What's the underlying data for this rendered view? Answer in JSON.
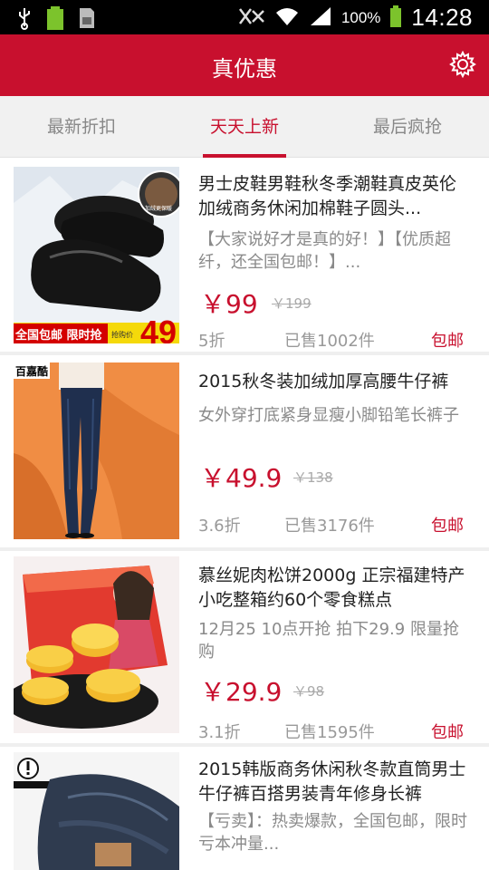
{
  "status_bar": {
    "battery_percent": "100%",
    "time": "14:28"
  },
  "app_bar": {
    "title": "真优惠"
  },
  "tabs": [
    {
      "label": "最新折扣",
      "active": false
    },
    {
      "label": "天天上新",
      "active": true
    },
    {
      "label": "最后疯抢",
      "active": false
    }
  ],
  "products": [
    {
      "title": "男士皮鞋男鞋秋冬季潮鞋真皮英伦加绒商务休闲加棉鞋子圆头...",
      "description": "【大家说好才是真的好！】【优质超纤，还全国包邮！】...",
      "price": "￥99",
      "original_price": "￥199",
      "discount": "5折",
      "sold": "已售1002件",
      "shipping": "包邮",
      "image_text": {
        "banner": "全国包邮 限时抢",
        "small": "抢购价",
        "number": "49",
        "badge": "加绒更保暖"
      }
    },
    {
      "title": "2015秋冬装加绒加厚高腰牛仔裤",
      "description": "女外穿打底紧身显瘦小脚铅笔长裤子",
      "price": "￥49.9",
      "original_price": "￥138",
      "discount": "3.6折",
      "sold": "已售3176件",
      "shipping": "包邮",
      "image_text": {
        "brand": "百嘉酷"
      }
    },
    {
      "title": "慕丝妮肉松饼2000g 正宗福建特产小吃整箱约60个零食糕点",
      "description": "12月25 10点开抢 拍下29.9 限量抢购",
      "price": "￥29.9",
      "original_price": "￥98",
      "discount": "3.1折",
      "sold": "已售1595件",
      "shipping": "包邮"
    },
    {
      "title": "2015韩版商务休闲秋冬款直筒男士牛仔裤百搭男装青年修身长裤",
      "description": "【亏卖】：热卖爆款，全国包邮，限时亏本冲量..."
    }
  ],
  "colors": {
    "accent": "#c8102e",
    "statusbar": "#000000"
  }
}
